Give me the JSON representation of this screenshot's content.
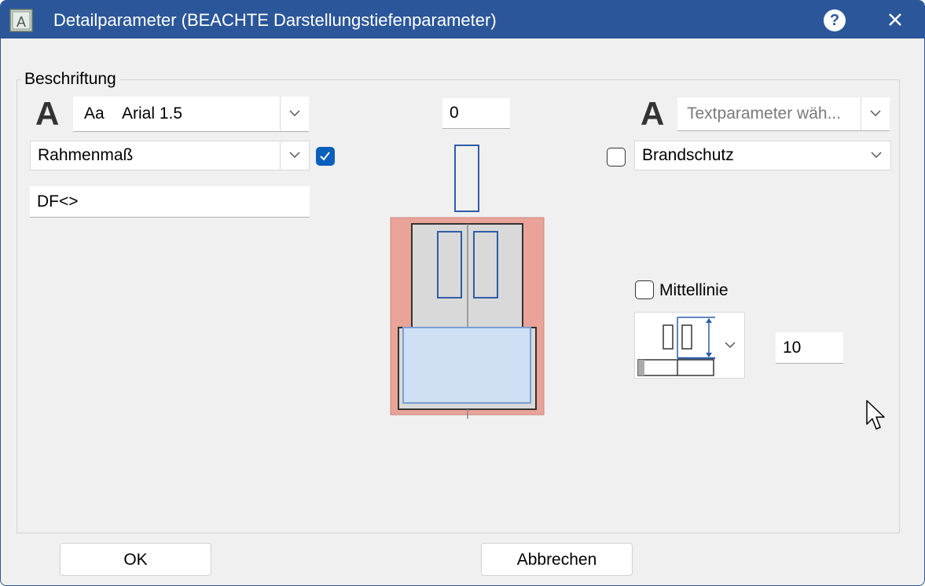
{
  "window": {
    "title": "Detailparameter (BEACHTE Darstellungstiefenparameter)",
    "help_label": "?",
    "app_icon_letter": "A",
    "accent": "#2b579a"
  },
  "group": {
    "label": "Beschriftung"
  },
  "left": {
    "text_style_icon": "A",
    "font_combo": {
      "prefix": "Aa",
      "value": "Arial 1.5"
    },
    "attribute_combo": {
      "value": "Rahmenmaß",
      "checked": true
    },
    "text_input": {
      "value": "DF<>"
    }
  },
  "center": {
    "offset_input": {
      "value": "0"
    }
  },
  "right": {
    "text_style_icon": "A",
    "textparam_combo": {
      "placeholder": "Textparameter wäh..."
    },
    "attribute_combo": {
      "value": "Brandschutz",
      "checked": false
    },
    "mittellinie": {
      "label": "Mittellinie",
      "checked": false
    },
    "height_input": {
      "value": "10"
    }
  },
  "footer": {
    "ok_label": "OK",
    "cancel_label": "Abbrechen"
  }
}
